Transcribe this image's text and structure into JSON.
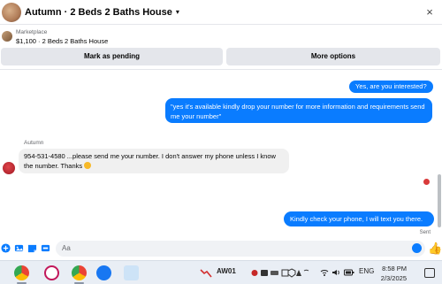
{
  "header": {
    "title": "Autumn · 2 Beds 2 Baths House",
    "caret": "▾",
    "close": "×"
  },
  "listing": {
    "category": "Marketplace",
    "description": "$1,100 · 2 Beds 2 Baths House"
  },
  "actions": {
    "pending": "Mark as pending",
    "more": "More options"
  },
  "messages": {
    "m1": "Yes, are you interested?",
    "m2": "\"yes it's available kindly drop your number for more information and requirements send me your number\"",
    "sender": "Autumn",
    "m3": "954-531-4580 ...please send me your number. I don't answer my phone unless I know the number. Thanks",
    "m4": "Kindly check your phone, I will text you there.",
    "sent": "Sent"
  },
  "composer": {
    "placeholder": "Aa",
    "like": "👍"
  },
  "taskbar": {
    "tray_app_label": "AW01",
    "lang": "ENG",
    "time": "8:58 PM",
    "date": "2/3/2025"
  },
  "colors": {
    "accent": "#0a7cff",
    "bubble_in": "#f0f0f0",
    "button_bg": "#e4e6eb"
  }
}
